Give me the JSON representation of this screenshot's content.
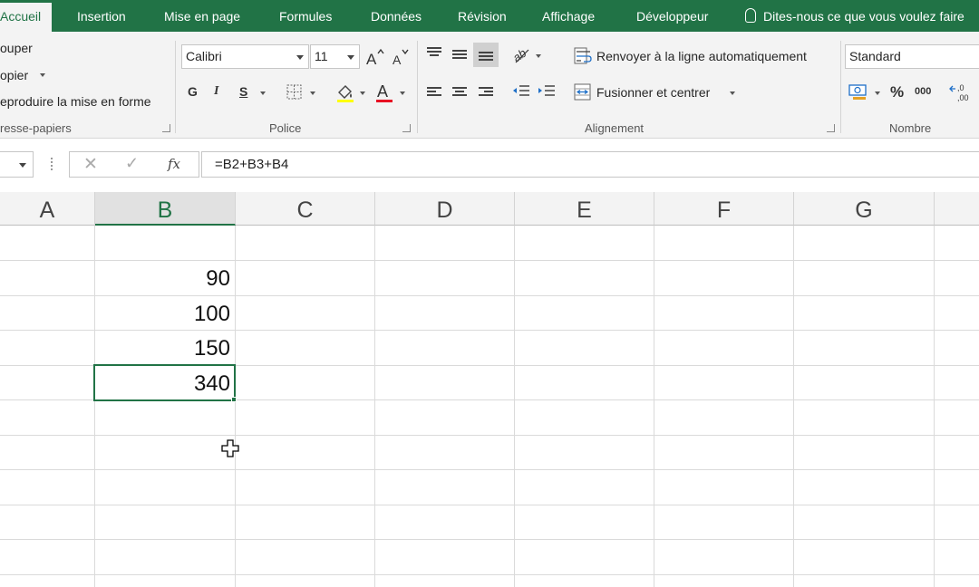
{
  "ribbon_tabs": [
    "Accueil",
    "Insertion",
    "Mise en page",
    "Formules",
    "Données",
    "Révision",
    "Affichage",
    "Développeur"
  ],
  "tell_me": "Dites-nous ce que vous voulez faire",
  "clipboard": {
    "cut": "ouper",
    "copy": "opier",
    "format_painter": "eproduire la mise en forme",
    "label": "resse-papiers"
  },
  "font": {
    "name": "Calibri",
    "size": "11",
    "bold": "G",
    "italic": "I",
    "underline": "S",
    "label": "Police",
    "font_color": "#e81123"
  },
  "alignment": {
    "wrap_text": "Renvoyer à la ligne automatiquement",
    "merge_center": "Fusionner et centrer",
    "label": "Alignement"
  },
  "number": {
    "format": "Standard",
    "percent": "%",
    "thousands": "000",
    "label": "Nombre"
  },
  "formula_bar": {
    "fx": "fx",
    "formula": "=B2+B3+B4"
  },
  "columns": [
    "A",
    "B",
    "C",
    "D",
    "E",
    "F",
    "G"
  ],
  "selected_column": "B",
  "cells": {
    "B2": "90",
    "B3": "100",
    "B4": "150",
    "B5": "340"
  },
  "colors": {
    "accent": "#217346"
  }
}
